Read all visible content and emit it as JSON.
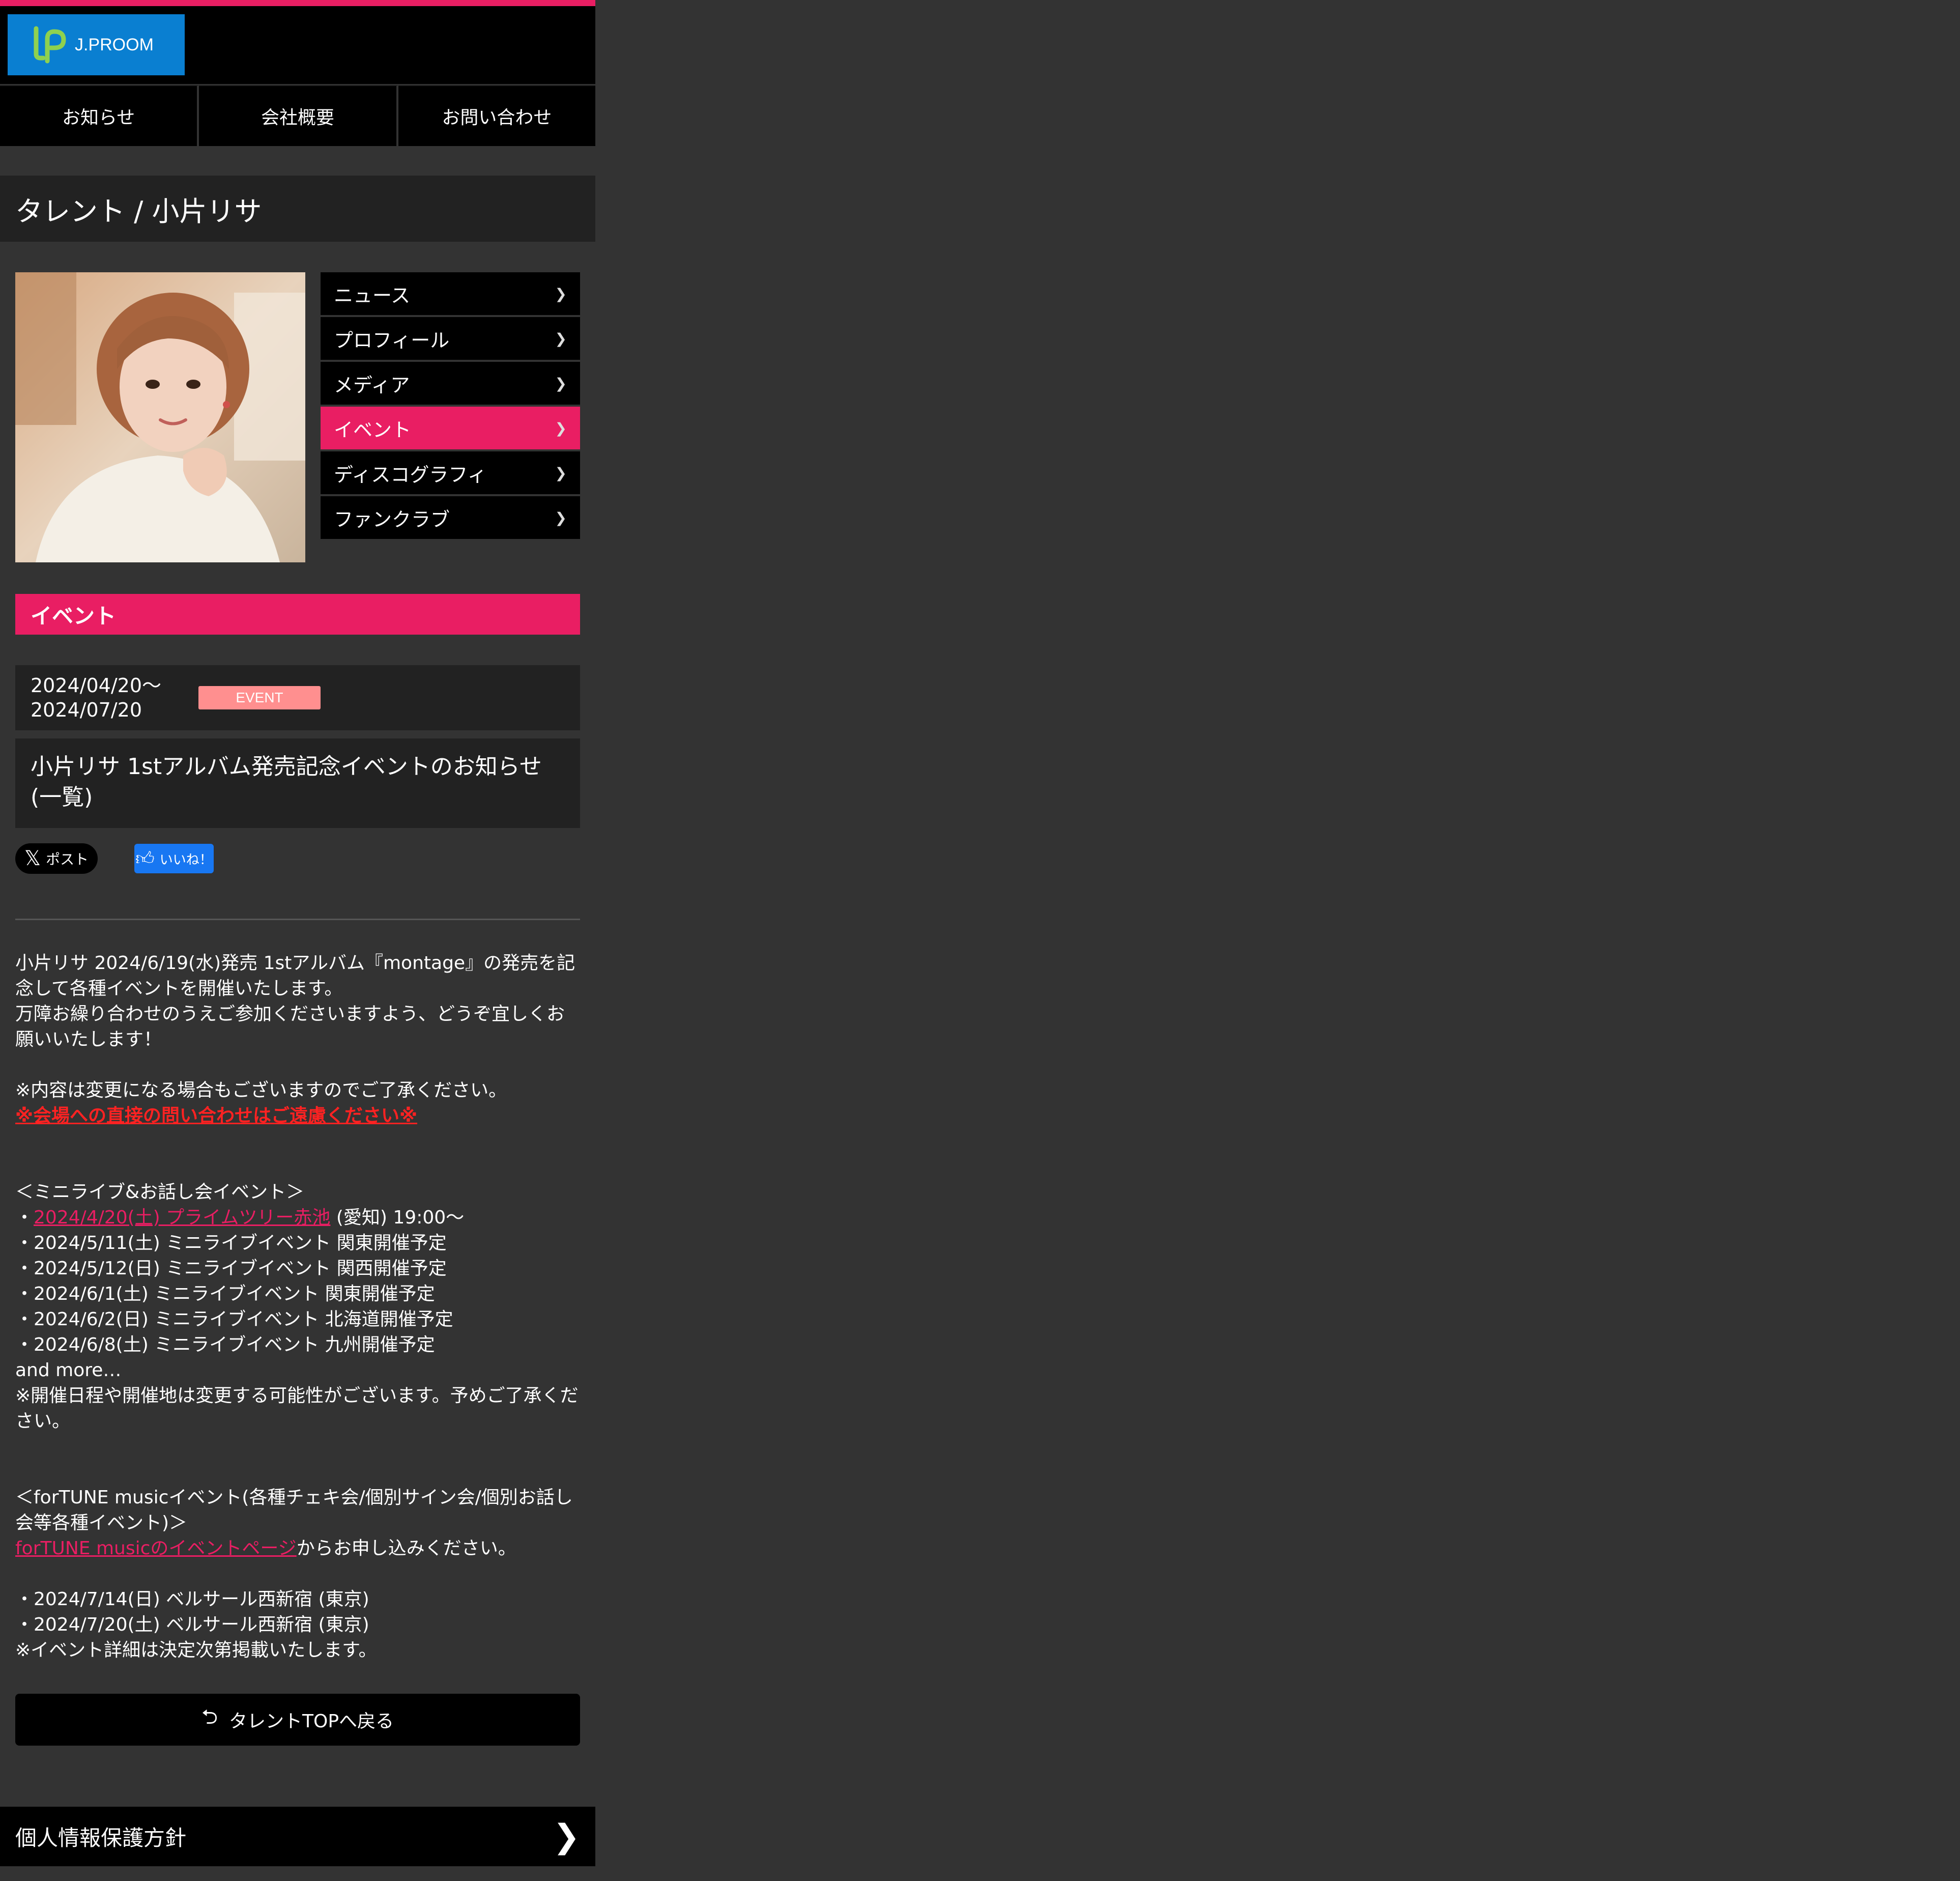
{
  "brand": {
    "name": "J.PROOM",
    "accent": "#e91e63",
    "logo_bg": "#0a7fd1"
  },
  "nav": [
    {
      "label": "お知らせ"
    },
    {
      "label": "会社概要"
    },
    {
      "label": "お問い合わせ"
    }
  ],
  "page_title": "タレント / 小片リサ",
  "talent_menu": [
    {
      "label": "ニュース",
      "active": false
    },
    {
      "label": "プロフィール",
      "active": false
    },
    {
      "label": "メディア",
      "active": false
    },
    {
      "label": "イベント",
      "active": true
    },
    {
      "label": "ディスコグラフィ",
      "active": false
    },
    {
      "label": "ファンクラブ",
      "active": false
    }
  ],
  "section_heading": "イベント",
  "event": {
    "date_start": "2024/04/20〜",
    "date_end": "2024/07/20",
    "badge": "EVENT",
    "title": "小片リサ 1stアルバム発売記念イベントのお知らせ(一覧)"
  },
  "share": {
    "x_label": "ポスト",
    "fb_label": "いいね！"
  },
  "body": {
    "intro1": "小片リサ 2024/6/19(水)発売 1stアルバム『montage』の発売を記念して各種イベントを開催いたします。",
    "intro2": "万障お繰り合わせのうえご参加くださいますよう、どうぞ宜しくお願いいたします！",
    "note1": "※内容は変更になる場合もございますのでご了承ください。",
    "warning": "※会場への直接の問い合わせはご遠慮ください※",
    "mini_heading": "＜ミニライブ&お話し会イベント＞",
    "mini_link": "2024/4/20(土) プライムツリー赤池",
    "mini_link_suffix": " (愛知) 19:00〜",
    "mini_items": [
      "・2024/5/11(土) ミニライブイベント 関東開催予定",
      "・2024/5/12(日) ミニライブイベント 関西開催予定",
      "・2024/6/1(土) ミニライブイベント 関東開催予定",
      "・2024/6/2(日) ミニライブイベント 北海道開催予定",
      "・2024/6/8(土) ミニライブイベント 九州開催予定"
    ],
    "and_more": "and more…",
    "mini_note": "※開催日程や開催地は変更する可能性がございます。予めご了承ください。",
    "fortune_heading": "＜forTUNE musicイベント(各種チェキ会/個別サイン会/個別お話し会等各種イベント)＞",
    "fortune_link": "forTUNE musicのイベントページ",
    "fortune_suffix": "からお申し込みください。",
    "fortune_items": [
      "・2024/7/14(日) ベルサール西新宿 (東京)",
      "・2024/7/20(土) ベルサール西新宿 (東京)"
    ],
    "fortune_note": "※イベント詳細は決定次第掲載いたします。"
  },
  "back_button": "タレントTOPへ戻る",
  "footer": {
    "privacy": "個人情報保護方針"
  }
}
